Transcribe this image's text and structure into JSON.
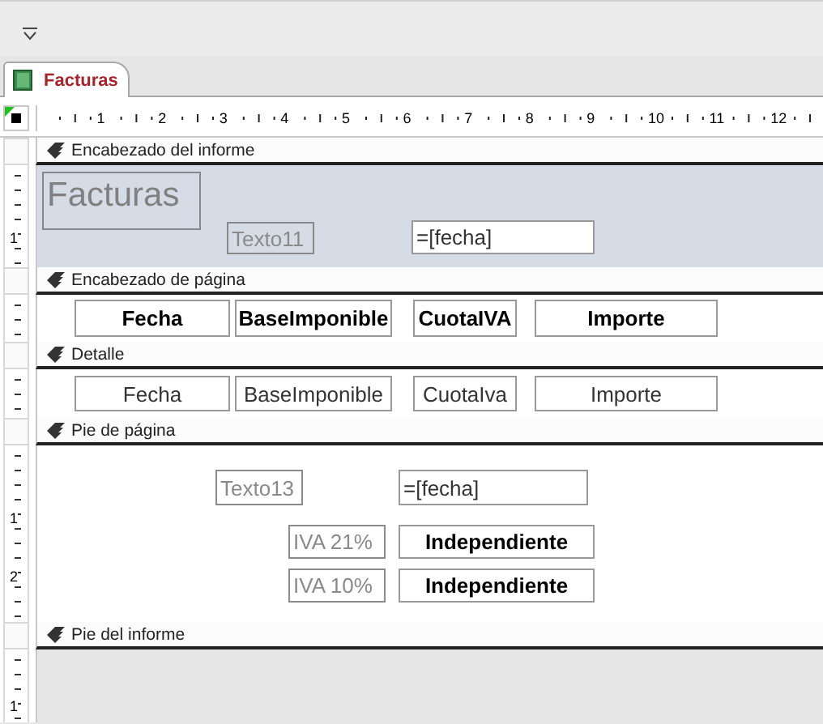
{
  "tab": {
    "label": "Facturas",
    "selected": true
  },
  "ruler": [
    "1",
    "2",
    "3",
    "4",
    "5",
    "6",
    "7",
    "8",
    "9",
    "10",
    "11",
    "12"
  ],
  "sections": [
    {
      "title": "Encabezado del informe",
      "shaded": true,
      "ruler_labels": [
        "1"
      ],
      "controls": [
        {
          "kind": "title",
          "text": "Facturas"
        },
        {
          "kind": "label",
          "text": "Texto11"
        },
        {
          "kind": "field",
          "text": "=[fecha]",
          "bold": false
        }
      ]
    },
    {
      "title": "Encabezado de página",
      "shaded": false,
      "controls": [
        {
          "kind": "field",
          "text": "Fecha",
          "bold": true
        },
        {
          "kind": "field",
          "text": "BaseImponible",
          "bold": true
        },
        {
          "kind": "field",
          "text": "CuotaIVA",
          "bold": true
        },
        {
          "kind": "field",
          "text": "Importe",
          "bold": true
        }
      ]
    },
    {
      "title": "Detalle",
      "shaded": false,
      "controls": [
        {
          "kind": "field",
          "text": "Fecha",
          "bold": false
        },
        {
          "kind": "field",
          "text": "BaseImponible",
          "bold": false
        },
        {
          "kind": "field",
          "text": "CuotaIva",
          "bold": false
        },
        {
          "kind": "field",
          "text": "Importe",
          "bold": false
        }
      ]
    },
    {
      "title": "Pie de página",
      "shaded": false,
      "ruler_labels": [
        "1",
        "2"
      ],
      "controls": [
        {
          "kind": "label",
          "text": "Texto13"
        },
        {
          "kind": "field",
          "text": "=[fecha]",
          "bold": false
        },
        {
          "kind": "label",
          "text": "IVA 21%"
        },
        {
          "kind": "field",
          "text": "Independiente",
          "bold": true
        },
        {
          "kind": "label",
          "text": "IVA 10%"
        },
        {
          "kind": "field",
          "text": "Independiente",
          "bold": true
        }
      ]
    },
    {
      "title": "Pie del informe",
      "ruler_labels": [
        "1"
      ]
    }
  ]
}
